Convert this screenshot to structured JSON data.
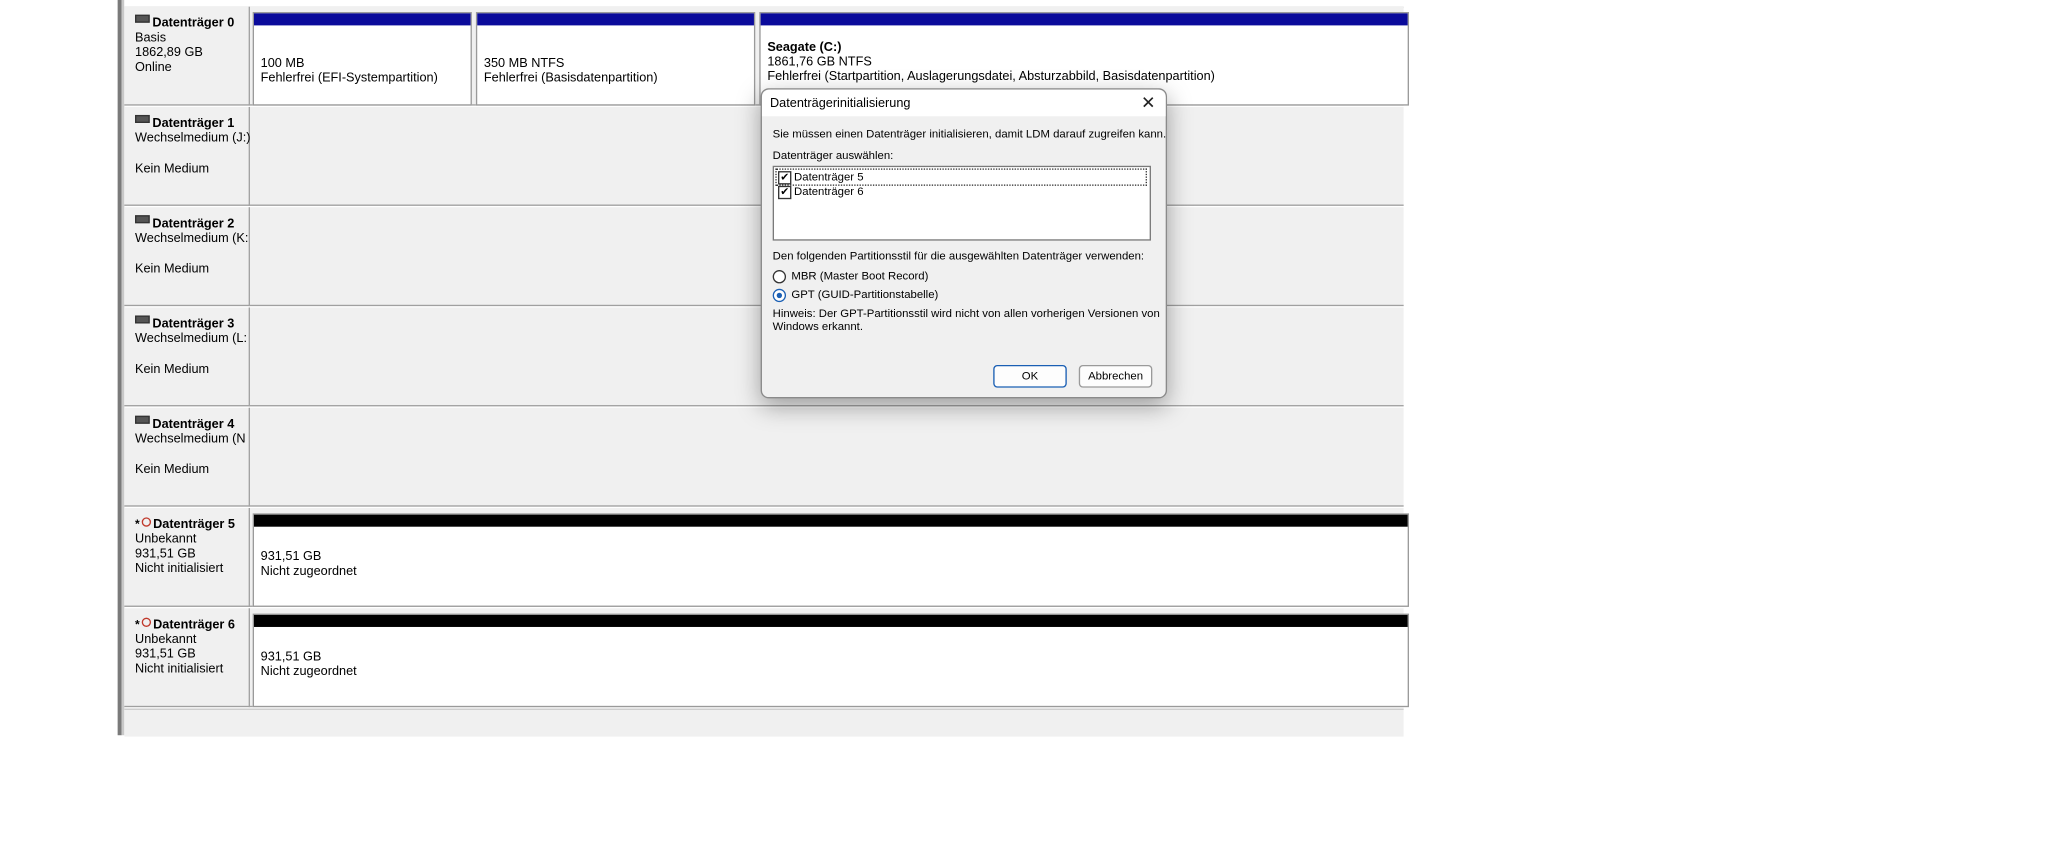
{
  "disks": [
    {
      "name": "Datenträger 0",
      "line2": "Basis",
      "line3": "1862,89 GB",
      "line4": "Online",
      "partitions": [
        {
          "title": "",
          "size": "100 MB",
          "status": "Fehlerfrei (EFI-Systempartition)"
        },
        {
          "title": "",
          "size": "350 MB NTFS",
          "status": "Fehlerfrei (Basisdatenpartition)"
        },
        {
          "title": "Seagate  (C:)",
          "size": "1861,76 GB NTFS",
          "status": "Fehlerfrei (Startpartition, Auslagerungsdatei, Absturzabbild, Basisdatenpartition)"
        }
      ]
    },
    {
      "name": "Datenträger 1",
      "line2": "Wechselmedium (J:)",
      "line3": "",
      "line4": "Kein Medium"
    },
    {
      "name": "Datenträger 2",
      "line2": "Wechselmedium (K:",
      "line3": "",
      "line4": "Kein Medium"
    },
    {
      "name": "Datenträger 3",
      "line2": "Wechselmedium (L:",
      "line3": "",
      "line4": "Kein Medium"
    },
    {
      "name": "Datenträger 4",
      "line2": "Wechselmedium (N",
      "line3": "",
      "line4": "Kein Medium"
    },
    {
      "name": "Datenträger 5",
      "prefix": "*",
      "line2": "Unbekannt",
      "line3": "931,51 GB",
      "line4": "Nicht initialisiert",
      "partitions": [
        {
          "size": "931,51 GB",
          "status": "Nicht zugeordnet"
        }
      ]
    },
    {
      "name": "Datenträger 6",
      "prefix": "*",
      "line2": "Unbekannt",
      "line3": "931,51 GB",
      "line4": "Nicht initialisiert",
      "partitions": [
        {
          "size": "931,51 GB",
          "status": "Nicht zugeordnet"
        }
      ]
    }
  ],
  "dialog": {
    "title": "Datenträgerinitialisierung",
    "close": "✕",
    "intro": "Sie müssen einen Datenträger initialisieren, damit LDM darauf zugreifen kann.",
    "select_label": "Datenträger auswählen:",
    "disk_list": [
      {
        "label": "Datenträger 5",
        "checked": "✔"
      },
      {
        "label": "Datenträger 6",
        "checked": "✔"
      }
    ],
    "style_label": "Den folgenden Partitionsstil für die ausgewählten Datenträger verwenden:",
    "option_mbr": "MBR (Master Boot Record)",
    "option_gpt": "GPT (GUID-Partitionstabelle)",
    "hint_line1": "Hinweis: Der GPT-Partitionsstil wird nicht von allen vorherigen Versionen von",
    "hint_line2": "Windows erkannt.",
    "ok": "OK",
    "cancel": "Abbrechen"
  },
  "colors": {
    "primary_bar": "#0b0b9b",
    "unallocated_bar": "#000000",
    "accent": "#1a5fb4"
  },
  "icons": {
    "disk": "disk-icon",
    "unknown_disk": "disk-unknown-icon"
  }
}
